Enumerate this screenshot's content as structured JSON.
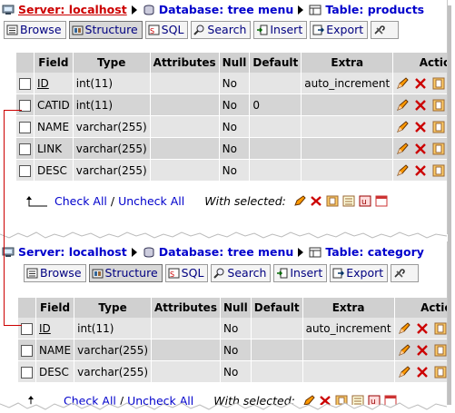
{
  "panel1": {
    "breadcrumb": {
      "server": "Server: localhost",
      "database": "Database: tree menu",
      "table": "Table: products"
    },
    "tabs": [
      "Browse",
      "Structure",
      "SQL",
      "Search",
      "Insert",
      "Export"
    ],
    "columns": [
      "Field",
      "Type",
      "Attributes",
      "Null",
      "Default",
      "Extra",
      "Actio"
    ],
    "rows": [
      {
        "field": "ID",
        "type": "int(11)",
        "attributes": "",
        "null": "No",
        "default": "",
        "extra": "auto_increment"
      },
      {
        "field": "CATID",
        "type": "int(11)",
        "attributes": "",
        "null": "No",
        "default": "0",
        "extra": ""
      },
      {
        "field": "NAME",
        "type": "varchar(255)",
        "attributes": "",
        "null": "No",
        "default": "",
        "extra": ""
      },
      {
        "field": "LINK",
        "type": "varchar(255)",
        "attributes": "",
        "null": "No",
        "default": "",
        "extra": ""
      },
      {
        "field": "DESC",
        "type": "varchar(255)",
        "attributes": "",
        "null": "No",
        "default": "",
        "extra": ""
      }
    ],
    "check_all": "Check All",
    "separator": "/",
    "uncheck_all": "Uncheck All",
    "with_selected": "With selected:"
  },
  "panel2": {
    "breadcrumb": {
      "server": "Server: localhost",
      "database": "Database: tree menu",
      "table": "Table: category"
    },
    "tabs": [
      "Browse",
      "Structure",
      "SQL",
      "Search",
      "Insert",
      "Export"
    ],
    "columns": [
      "Field",
      "Type",
      "Attributes",
      "Null",
      "Default",
      "Extra",
      "Actio"
    ],
    "rows": [
      {
        "field": "ID",
        "type": "int(11)",
        "attributes": "",
        "null": "No",
        "default": "",
        "extra": "auto_increment"
      },
      {
        "field": "NAME",
        "type": "varchar(255)",
        "attributes": "",
        "null": "No",
        "default": "",
        "extra": ""
      },
      {
        "field": "DESC",
        "type": "varchar(255)",
        "attributes": "",
        "null": "No",
        "default": "",
        "extra": ""
      }
    ],
    "check_all": "Check All",
    "separator": "/",
    "uncheck_all": "Uncheck All",
    "with_selected": "With selected:"
  },
  "colors": {
    "link": "#0000cc",
    "server_active": "#cc0000",
    "header_bg": "#d0d0d0",
    "row_odd": "#e5e5e5",
    "row_even": "#d5d5d5",
    "connector": "#cc0000"
  }
}
